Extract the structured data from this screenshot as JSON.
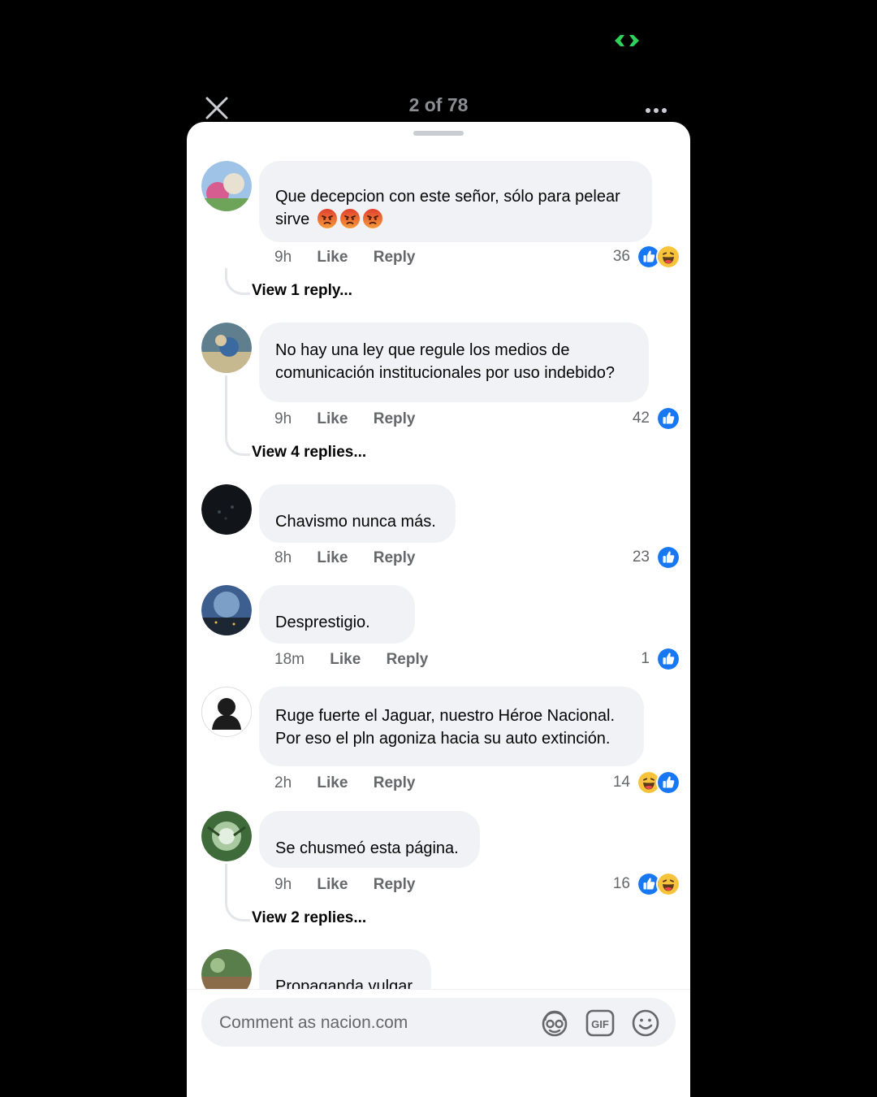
{
  "header": {
    "counter": "2 of 78"
  },
  "colors": {
    "like_blue": "#1877f2",
    "bubble_bg": "#f0f2f5",
    "meta_gray": "#65676b",
    "status_green": "#30d158"
  },
  "comments": [
    {
      "author": "",
      "text": "Que decepcion con este señor, sólo para pelear sirve",
      "emojis": [
        "angry-face-icon",
        "angry-face-icon",
        "angry-face-icon"
      ],
      "time": "9h",
      "like_label": "Like",
      "reply_label": "Reply",
      "reaction_count": "36",
      "reactions": [
        "like-reaction-icon",
        "haha-reaction-icon"
      ],
      "view_replies": "View 1 reply..."
    },
    {
      "author": "",
      "text": "No hay una ley que regule los medios de comunicación institucionales por uso indebido?",
      "time": "9h",
      "like_label": "Like",
      "reply_label": "Reply",
      "reaction_count": "42",
      "reactions": [
        "like-reaction-icon"
      ],
      "view_replies": "View 4 replies..."
    },
    {
      "author": "",
      "text": "Chavismo nunca más.",
      "time": "8h",
      "like_label": "Like",
      "reply_label": "Reply",
      "reaction_count": "23",
      "reactions": [
        "like-reaction-icon"
      ]
    },
    {
      "author": "",
      "text": "Desprestigio.",
      "time": "18m",
      "like_label": "Like",
      "reply_label": "Reply",
      "reaction_count": "1",
      "reactions": [
        "like-reaction-icon"
      ]
    },
    {
      "author": "",
      "text": "Ruge fuerte el Jaguar, nuestro Héroe Nacional. Por eso el pln agoniza hacia su auto extinción.",
      "time": "2h",
      "like_label": "Like",
      "reply_label": "Reply",
      "reaction_count": "14",
      "reactions": [
        "haha-reaction-icon",
        "like-reaction-icon"
      ]
    },
    {
      "author": "",
      "text": "Se chusmeó esta página.",
      "time": "9h",
      "like_label": "Like",
      "reply_label": "Reply",
      "reaction_count": "16",
      "reactions": [
        "like-reaction-icon",
        "haha-reaction-icon"
      ],
      "view_replies": "View 2 replies..."
    },
    {
      "author": "",
      "text": "Propaganda vulgar"
    }
  ],
  "composer": {
    "placeholder": "Comment as nacion.com",
    "icons": [
      "avatar-sticker-icon",
      "gif-icon",
      "emoji-icon"
    ]
  }
}
